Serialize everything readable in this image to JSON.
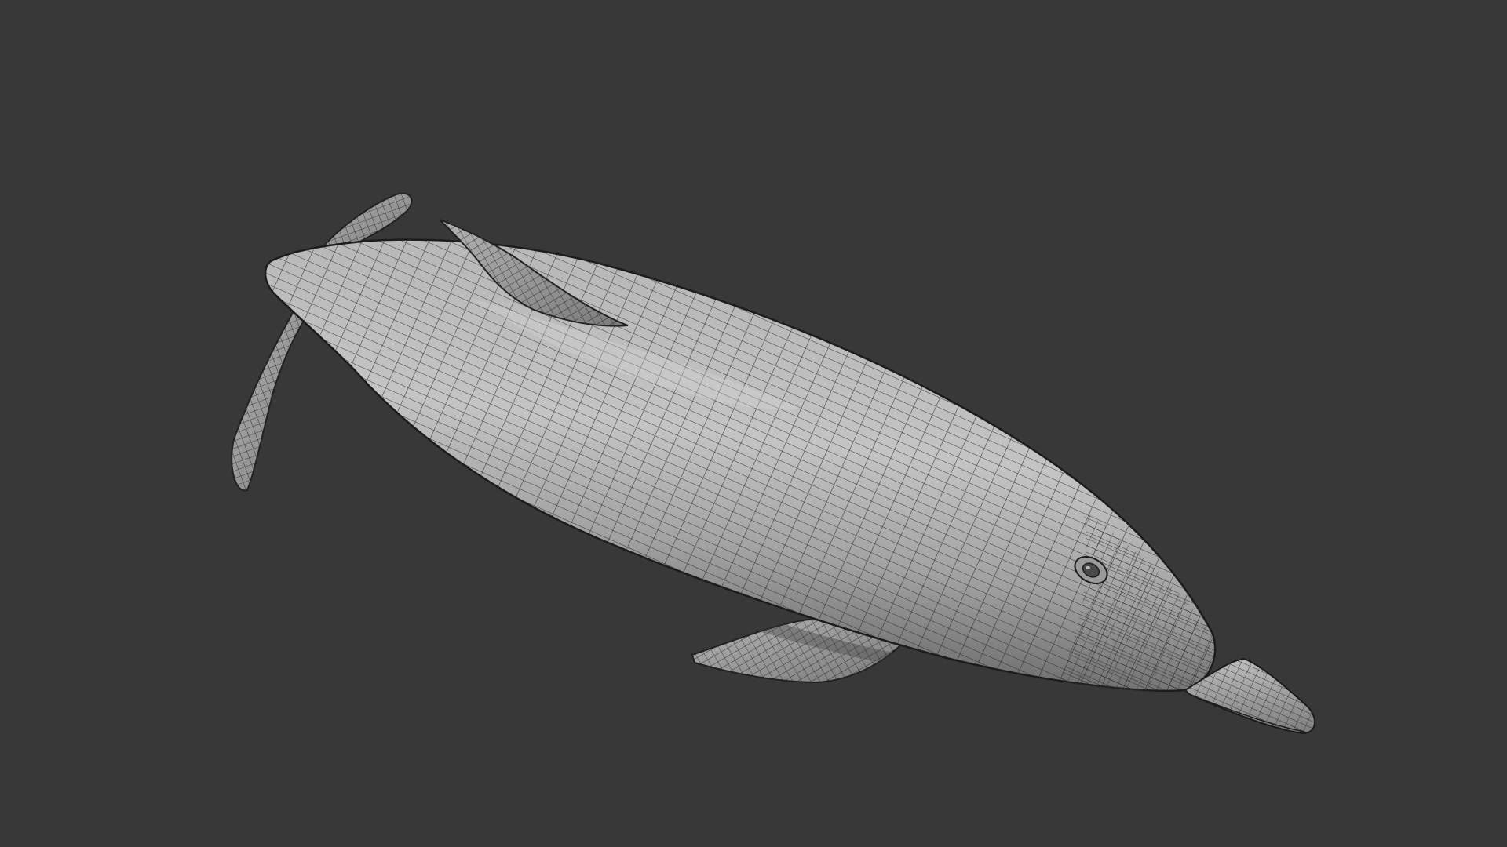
{
  "viewport": {
    "background_color": "#383838",
    "shading_mode": "solid-wireframe"
  },
  "model": {
    "subject": "dolphin",
    "surface_color": "#a8a8a8",
    "highlight_color": "#cfcfcf",
    "shadow_color": "#5a5a5a",
    "wire_color": "#1e1e1e",
    "parts": [
      "body",
      "dorsal-fin",
      "tail-fluke-upper",
      "tail-fluke-lower",
      "pectoral-fin",
      "beak",
      "eye"
    ]
  }
}
